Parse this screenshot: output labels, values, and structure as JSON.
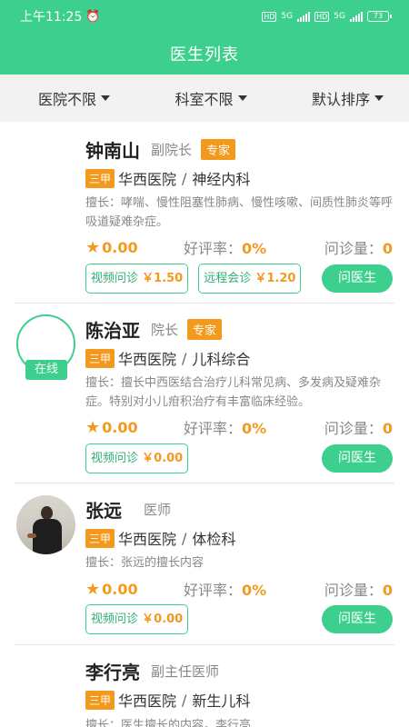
{
  "status": {
    "time": "上午11:25",
    "battery": "73"
  },
  "header": {
    "title": "医生列表"
  },
  "filters": [
    {
      "label": "医院不限"
    },
    {
      "label": "科室不限"
    },
    {
      "label": "默认排序"
    }
  ],
  "labels": {
    "rating_prefix": "好评率：",
    "count_prefix": "问诊量：",
    "ask_button": "问医生",
    "expert": "专家",
    "online": "在线",
    "video_consult": "视频问诊",
    "remote_consult": "远程会诊"
  },
  "colors": {
    "primary": "#3ccf8e",
    "accent": "#f39a1e"
  },
  "doctors": [
    {
      "name": "钟南山",
      "title": "副院长",
      "grade": "三甲",
      "hospital": "华西医院",
      "department": "神经内科",
      "specialty": "擅长：哮喘、慢性阻塞性肺病、慢性咳嗽、间质性肺炎等呼吸道疑难杂症。",
      "score": "0.00",
      "praise": "0%",
      "count": "0",
      "video_price": "￥1.50",
      "remote_price": "￥1.20"
    },
    {
      "name": "陈治亚",
      "title": "院长",
      "grade": "三甲",
      "hospital": "华西医院",
      "department": "儿科综合",
      "specialty": "擅长：擅长中西医结合治疗儿科常见病、多发病及疑难杂症。特别对小儿疳积治疗有丰富临床经验。",
      "score": "0.00",
      "praise": "0%",
      "count": "0",
      "video_price": "￥0.00"
    },
    {
      "name": "张远",
      "title": "医师",
      "grade": "三甲",
      "hospital": "华西医院",
      "department": "体检科",
      "specialty": "擅长：张远的擅长内容",
      "score": "0.00",
      "praise": "0%",
      "count": "0",
      "video_price": "￥0.00"
    },
    {
      "name": "李行亮",
      "title": "副主任医师",
      "grade": "三甲",
      "hospital": "华西医院",
      "department": "新生儿科",
      "specialty": "擅长：医生擅长的内容，李行亮"
    }
  ]
}
